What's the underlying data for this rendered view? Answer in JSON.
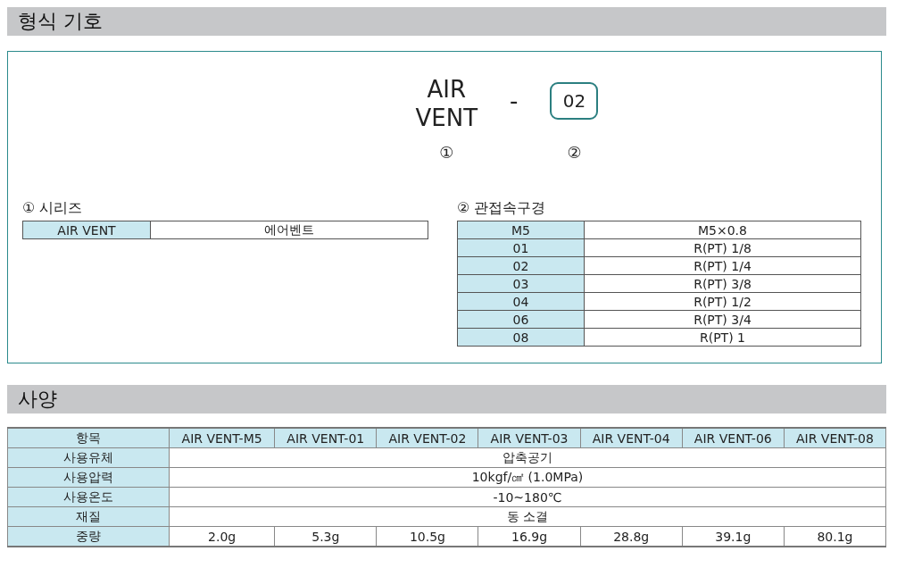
{
  "model_section": {
    "title": "형식 기호",
    "code": {
      "parts": [
        {
          "kind": "text",
          "text": "AIR\nVENT",
          "marker": "①"
        },
        {
          "kind": "separator",
          "text": "-"
        },
        {
          "kind": "boxed",
          "text": "02",
          "marker": "②"
        }
      ]
    },
    "series": {
      "title": "① 시리즈",
      "rows": [
        {
          "code": "AIR VENT",
          "description": "에어벤트"
        }
      ]
    },
    "port": {
      "title": "② 관접속구경",
      "rows": [
        {
          "code": "M5",
          "description": "M5×0.8"
        },
        {
          "code": "01",
          "description": "R(PT) 1/8"
        },
        {
          "code": "02",
          "description": "R(PT) 1/4"
        },
        {
          "code": "03",
          "description": "R(PT) 3/8"
        },
        {
          "code": "04",
          "description": "R(PT) 1/2"
        },
        {
          "code": "06",
          "description": "R(PT) 3/4"
        },
        {
          "code": "08",
          "description": "R(PT) 1"
        }
      ]
    }
  },
  "spec_section": {
    "title": "사양",
    "table": {
      "header": [
        "항목",
        "AIR VENT-M5",
        "AIR VENT-01",
        "AIR VENT-02",
        "AIR VENT-03",
        "AIR VENT-04",
        "AIR VENT-06",
        "AIR VENT-08"
      ],
      "rows": [
        {
          "kind": "merged",
          "label": "사용유체",
          "values": [
            "압축공기"
          ]
        },
        {
          "kind": "merged",
          "label": "사용압력",
          "values": [
            "10kgf/㎠ (1.0MPa)"
          ]
        },
        {
          "kind": "merged",
          "label": "사용온도",
          "values": [
            "-10~180℃"
          ]
        },
        {
          "kind": "merged",
          "label": "재질",
          "values": [
            "동 소결"
          ]
        },
        {
          "kind": "per_model",
          "label": "중량",
          "values": [
            "2.0g",
            "5.3g",
            "10.5g",
            "16.9g",
            "28.8g",
            "39.1g",
            "80.1g"
          ]
        }
      ]
    }
  }
}
